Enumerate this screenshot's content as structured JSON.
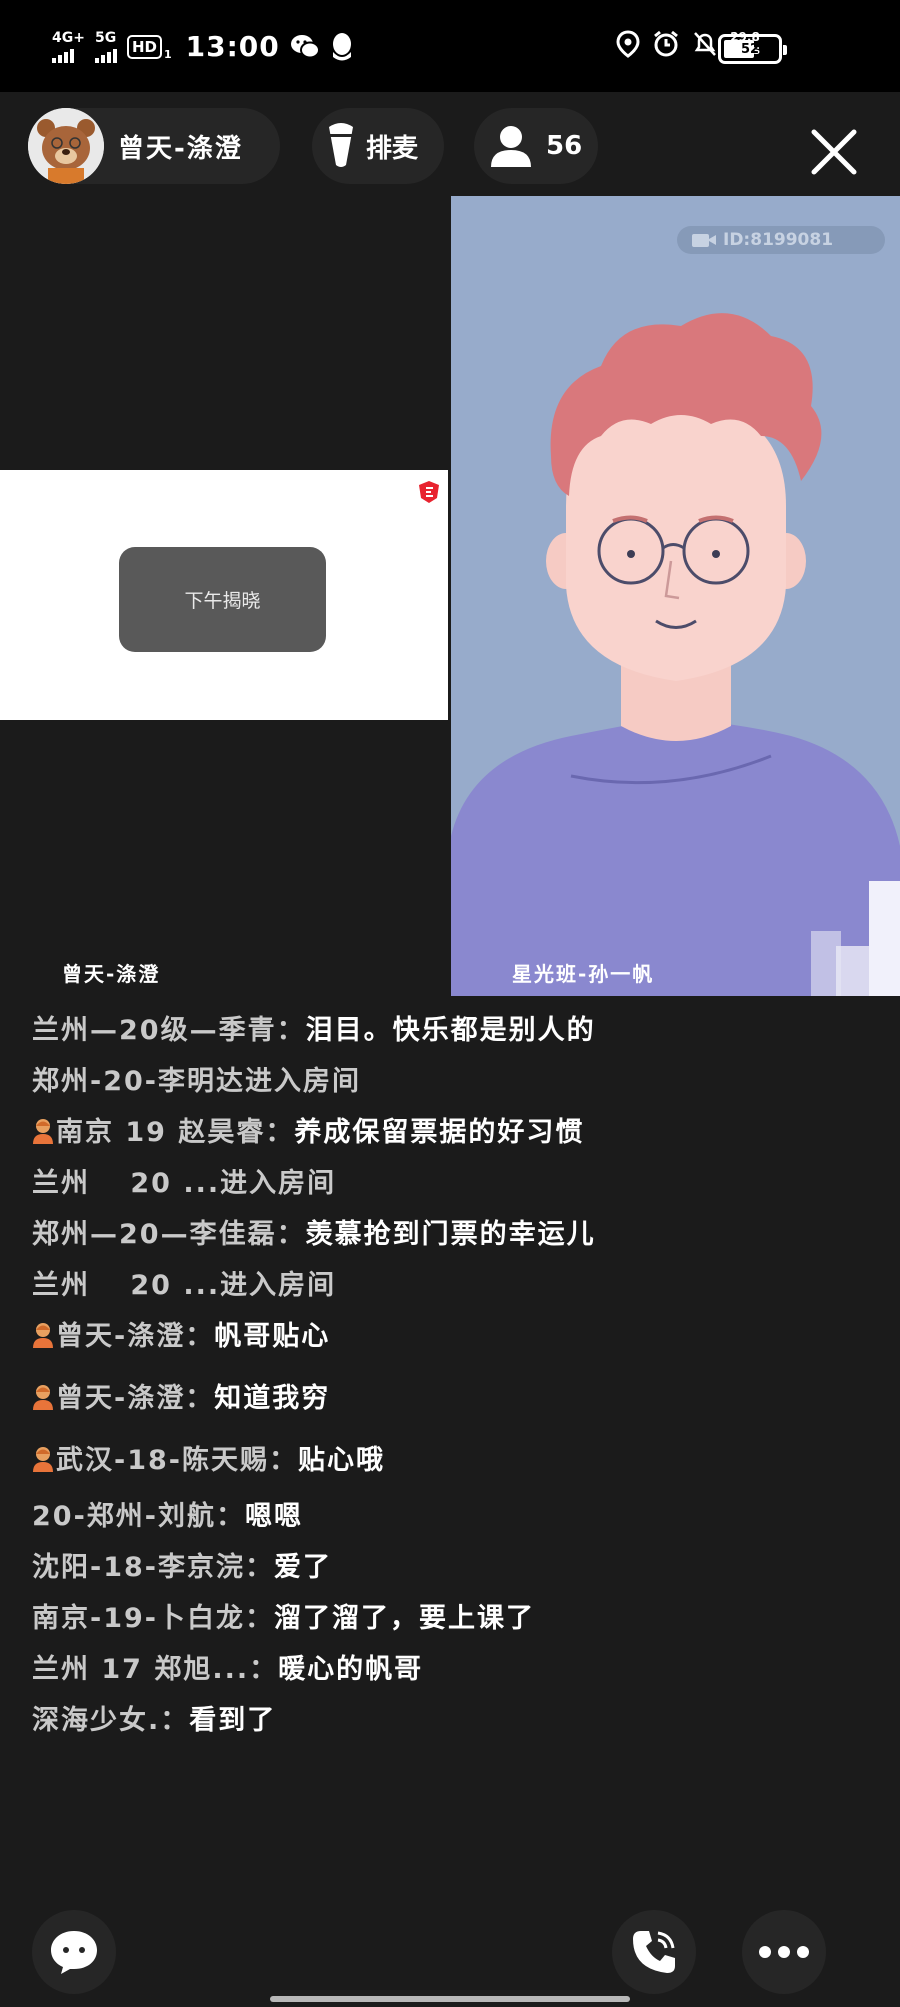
{
  "status_bar": {
    "net1_label": "4G+",
    "net2_label": "5G",
    "hd_label": "HD",
    "sim_index": "1",
    "time": "13:00",
    "net_speed_value": "29.8",
    "net_speed_unit": "KB/s",
    "battery_level": "52"
  },
  "header": {
    "host_name": "曾天-涤澄",
    "queue_label": "排麦",
    "viewer_count": "56"
  },
  "video": {
    "screen_share_button": "下午揭晓",
    "left_label": "曾天-涤澄",
    "watermark_id": "ID:8199081",
    "right_label": "星光班-孙一帆"
  },
  "chat": {
    "messages": [
      {
        "who": "兰州—20级—季青：",
        "text": "泪目。快乐都是别人的"
      },
      {
        "system": "郑州-20-李明达进入房间"
      },
      {
        "who": "南京 19 赵昊睿：",
        "text": "养成保留票据的好习惯"
      },
      {
        "system": "兰州　 20 ...进入房间"
      },
      {
        "who": "郑州—20—李佳磊：",
        "text": "羡慕抢到门票的幸运儿"
      },
      {
        "system": "兰州　 20 ...进入房间"
      },
      {
        "who": "曾天-涤澄：",
        "text": "帆哥贴心"
      },
      {
        "who": "曾天-涤澄：",
        "text": "知道我穷"
      },
      {
        "who": "武汉-18-陈天赐：",
        "text": "贴心哦"
      },
      {
        "who": "20-郑州-刘航：",
        "text": "嗯嗯"
      },
      {
        "who": "沈阳-18-李京浣：",
        "text": "爱了"
      },
      {
        "who": "南京-19-卜白龙：",
        "text": "溜了溜了，要上课了"
      },
      {
        "who": "兰州 17 郑旭...：",
        "text": "暖心的帆哥"
      },
      {
        "who": "深海少女.：",
        "text": "看到了"
      }
    ]
  },
  "icons": {
    "avatar": "bear-avatar",
    "queue": "microphone-icon",
    "viewers": "person-icon",
    "close": "close-icon",
    "chat": "chat-bubble-icon",
    "call": "phone-icon",
    "more": "more-dots-icon",
    "badge": "user-badge-icon"
  }
}
